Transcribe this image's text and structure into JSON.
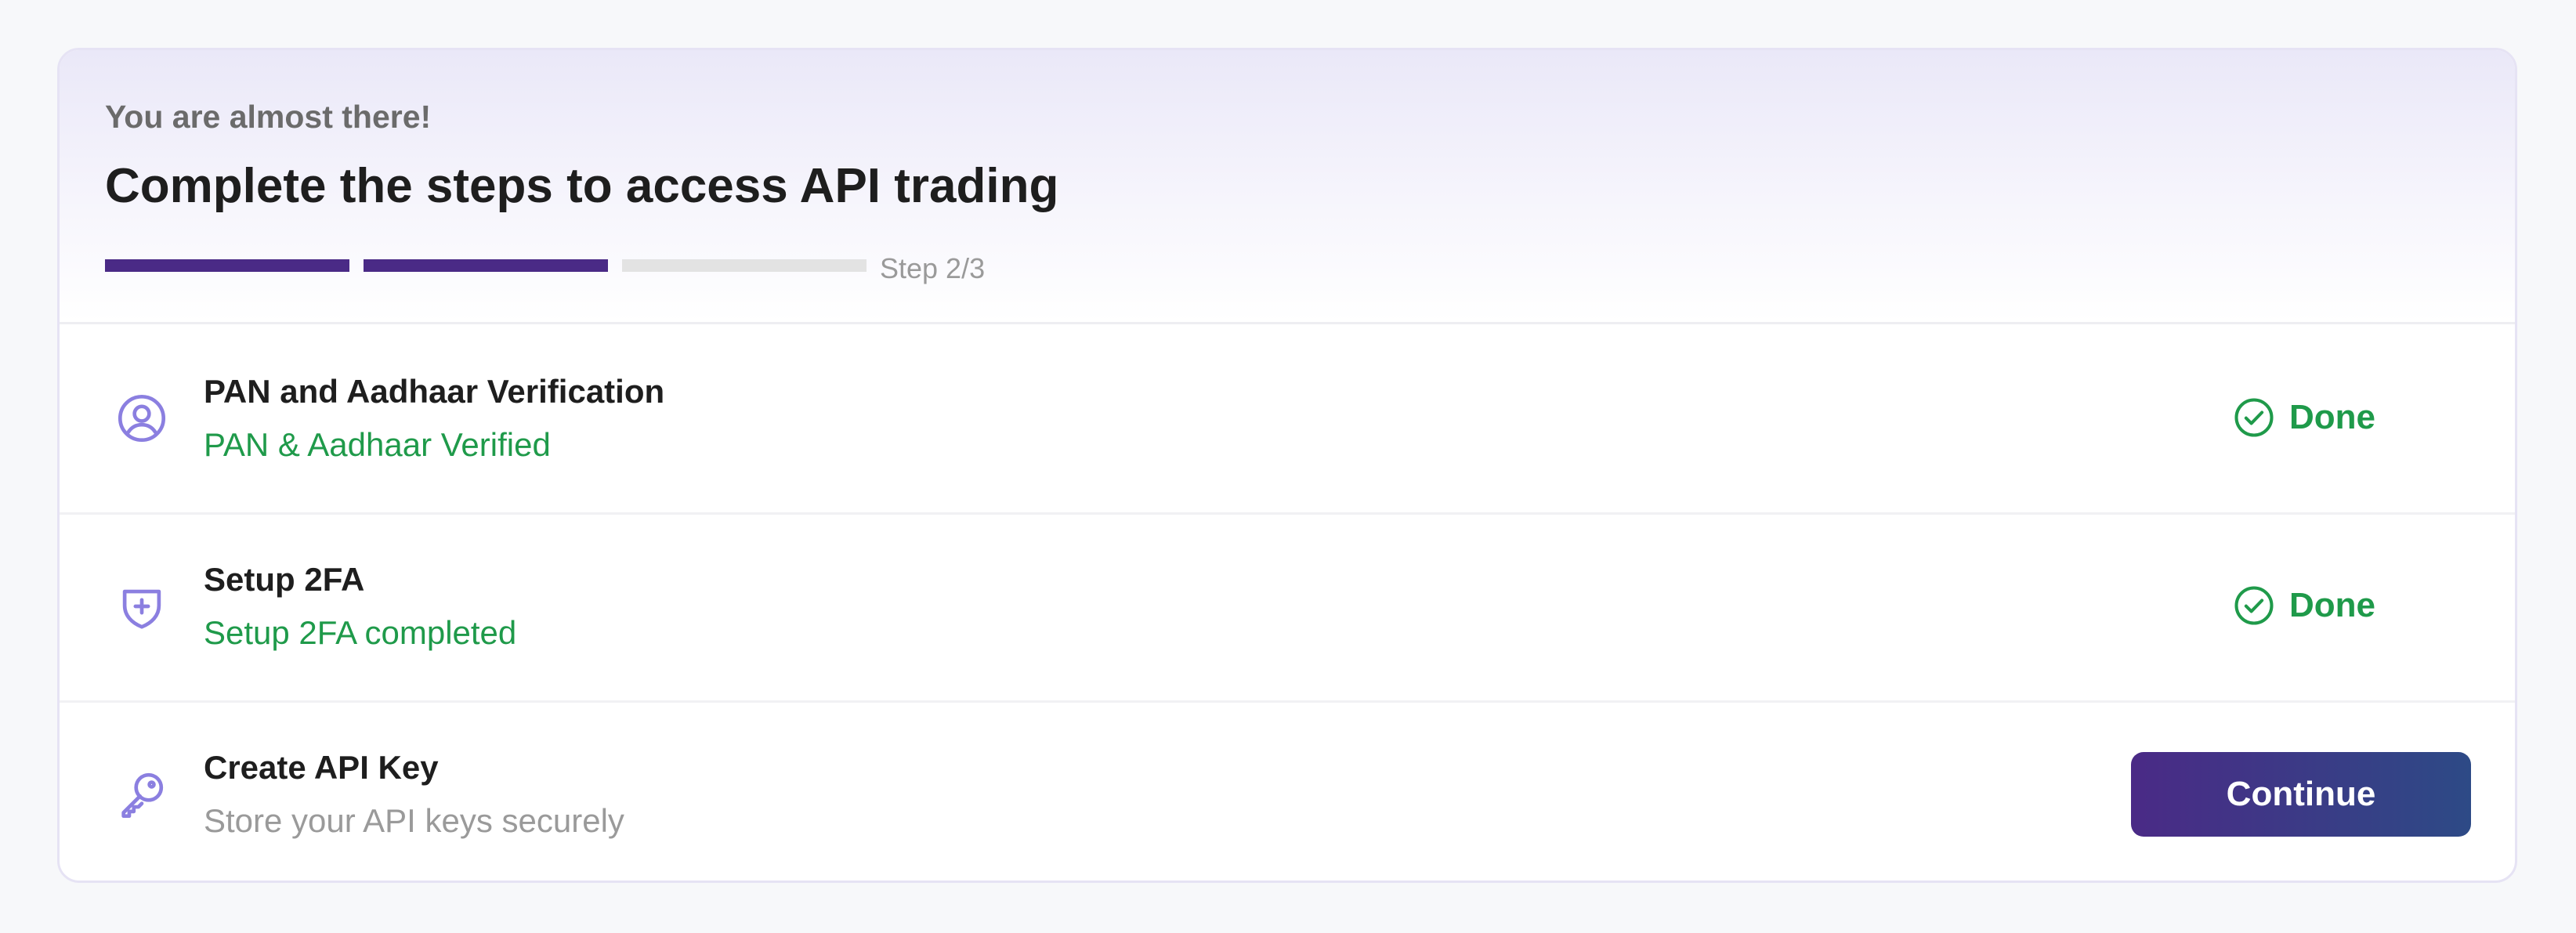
{
  "header": {
    "eyebrow": "You are almost there!",
    "title": "Complete the steps to access API trading",
    "progress": {
      "current_step": 2,
      "total_steps": 3,
      "label": "Step 2/3"
    }
  },
  "steps": [
    {
      "title": "PAN and Aadhaar Verification",
      "subtitle": "PAN & Aadhaar Verified",
      "status": "Done",
      "icon": "user-circle-icon"
    },
    {
      "title": "Setup 2FA",
      "subtitle": "Setup 2FA completed",
      "status": "Done",
      "icon": "shield-plus-icon"
    },
    {
      "title": "Create API Key",
      "subtitle": "Store your API keys securely",
      "action_label": "Continue",
      "icon": "key-icon"
    }
  ],
  "colors": {
    "accent": "#4a2a86",
    "success": "#1f9a4a",
    "icon": "#8b7fe0",
    "progress_empty": "#e3e3e3"
  }
}
